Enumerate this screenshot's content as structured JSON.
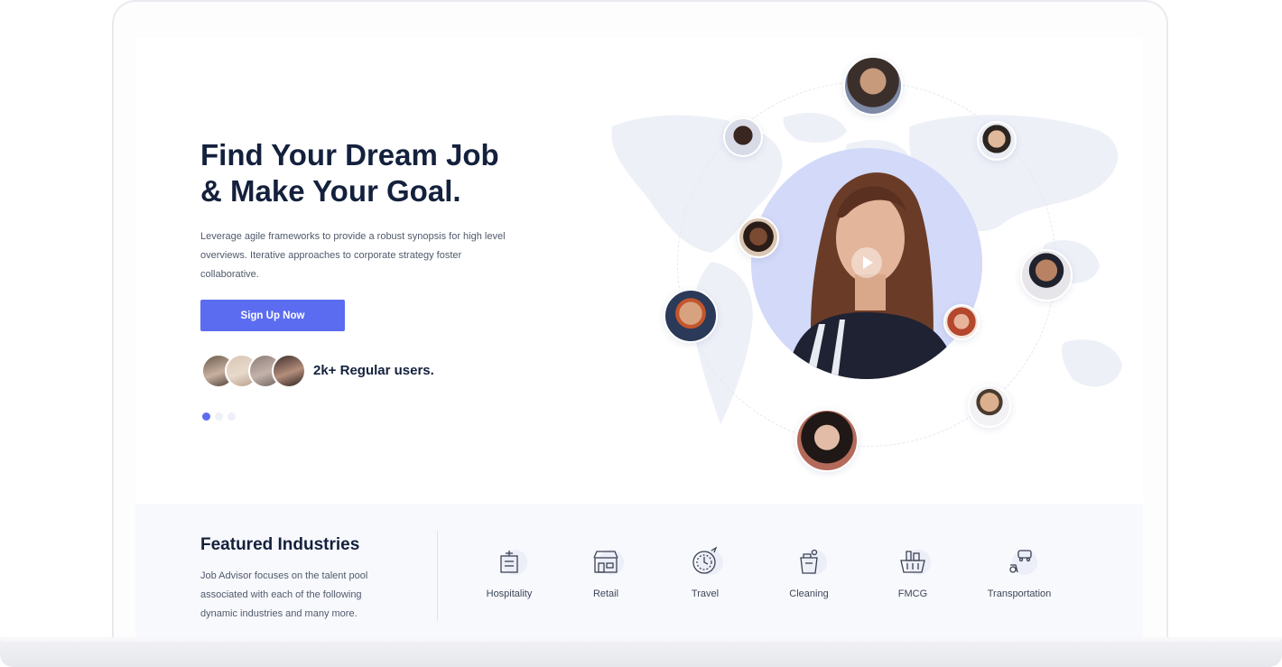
{
  "hero": {
    "title_line1": "Find Your Dream Job",
    "title_line2": "& Make Your Goal.",
    "description": "Leverage agile frameworks to provide a robust synopsis for high level overviews. Iterative approaches to corporate strategy foster collaborative.",
    "cta_label": "Sign Up Now",
    "users_text": "2k+ Regular users.",
    "slider_dots": 3,
    "active_dot": 1
  },
  "media": {
    "play_icon": "play-icon"
  },
  "featured": {
    "title": "Featured Industries",
    "description": "Job Advisor focuses on the talent pool associated with each of the following dynamic industries and many more.",
    "industries": [
      {
        "label": "Hospitality",
        "icon": "hospitality-icon"
      },
      {
        "label": "Retail",
        "icon": "retail-icon"
      },
      {
        "label": "Travel",
        "icon": "travel-icon"
      },
      {
        "label": "Cleaning",
        "icon": "cleaning-icon"
      },
      {
        "label": "FMCG",
        "icon": "fmcg-icon"
      },
      {
        "label": "Transportation",
        "icon": "transportation-icon"
      }
    ]
  },
  "colors": {
    "accent": "#5b6cf1",
    "heading": "#14213d",
    "body_text": "#505a6b",
    "band_bg": "#f8f9fd"
  }
}
